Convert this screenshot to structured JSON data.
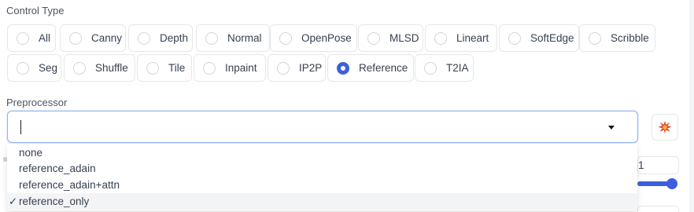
{
  "control_type": {
    "label": "Control Type",
    "options": [
      "All",
      "Canny",
      "Depth",
      "Normal",
      "OpenPose",
      "MLSD",
      "Lineart",
      "SoftEdge",
      "Scribble",
      "Seg",
      "Shuffle",
      "Tile",
      "Inpaint",
      "IP2P",
      "Reference",
      "T2IA"
    ],
    "selected": "Reference"
  },
  "preprocessor": {
    "label": "Preprocessor",
    "value": "",
    "options": [
      "none",
      "reference_adain",
      "reference_adain+attn",
      "reference_only"
    ],
    "selected": "reference_only",
    "check_glyph": "✓"
  },
  "explode_button": {
    "icon": "explosion-icon"
  },
  "background_controls": {
    "number_value": "1"
  },
  "colors": {
    "accent": "#3b5fe0",
    "focus_border": "#93b4f2"
  }
}
